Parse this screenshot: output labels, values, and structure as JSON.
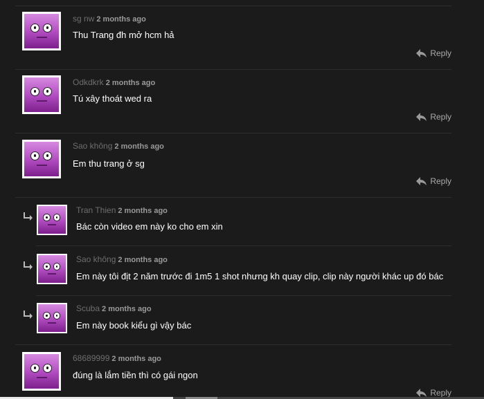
{
  "comments": [
    {
      "author": "sg nw",
      "time": "2 months ago",
      "text": "Thu Trang đh mở hcm hả",
      "reply": "Reply"
    },
    {
      "author": "Odkdkrk",
      "time": "2 months ago",
      "text": "Tú xây thoát wed ra",
      "reply": "Reply"
    },
    {
      "author": "Sao không",
      "time": "2 months ago",
      "text": "Em thu trang ở sg",
      "reply": "Reply"
    },
    {
      "author": "Tran Thien",
      "time": "2 months ago",
      "text": "Bác còn video em này ko cho em xin"
    },
    {
      "author": "Sao không",
      "time": "2 months ago",
      "text": "Em này tôi địt 2 năm trước đi 1m5 1 shot nhưng kh quay clip, clip này người khác up đó bác"
    },
    {
      "author": "Scuba",
      "time": "2 months ago",
      "text": "Em này book kiểu gì vậy bác"
    },
    {
      "author": "68689999",
      "time": "2 months ago",
      "text": "đúng là lắm tiền thì có gái ngon",
      "reply": "Reply"
    }
  ],
  "icons": {
    "reply": "reply-arrow-icon",
    "indent": "nested-reply-arrow-icon",
    "avatar": "face-avatar-icon"
  },
  "colors": {
    "background": "#1b1b1b",
    "avatar_purple": "#b44fc3",
    "meta": "#6e6e6e"
  }
}
